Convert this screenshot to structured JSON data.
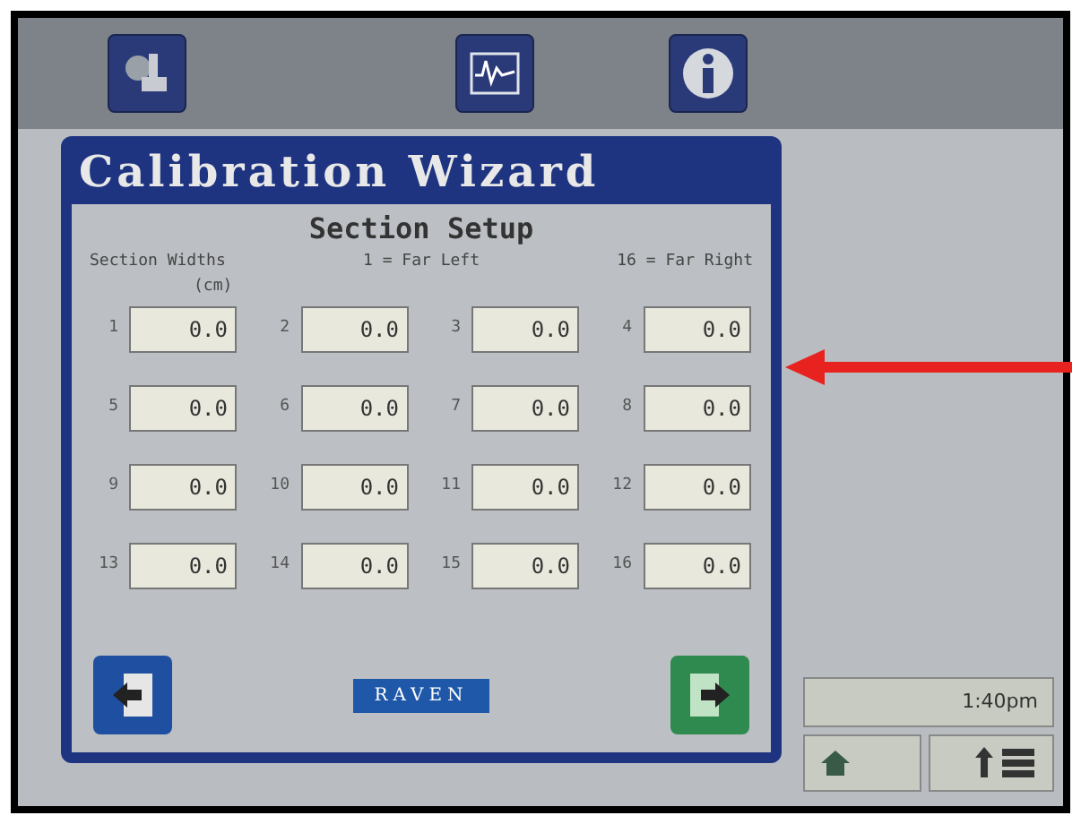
{
  "dialog": {
    "title": "Calibration Wizard",
    "subtitle": "Section Setup",
    "headers": [
      "Section Widths",
      "1 = Far Left",
      "16 = Far Right"
    ],
    "unit": "(cm)",
    "sections": [
      {
        "label": "1",
        "value": "0.0"
      },
      {
        "label": "2",
        "value": "0.0"
      },
      {
        "label": "3",
        "value": "0.0"
      },
      {
        "label": "4",
        "value": "0.0"
      },
      {
        "label": "5",
        "value": "0.0"
      },
      {
        "label": "6",
        "value": "0.0"
      },
      {
        "label": "7",
        "value": "0.0"
      },
      {
        "label": "8",
        "value": "0.0"
      },
      {
        "label": "9",
        "value": "0.0"
      },
      {
        "label": "10",
        "value": "0.0"
      },
      {
        "label": "11",
        "value": "0.0"
      },
      {
        "label": "12",
        "value": "0.0"
      },
      {
        "label": "13",
        "value": "0.0"
      },
      {
        "label": "14",
        "value": "0.0"
      },
      {
        "label": "15",
        "value": "0.0"
      },
      {
        "label": "16",
        "value": "0.0"
      }
    ],
    "logo": "RAVEN"
  },
  "status": {
    "time": "1:40pm"
  }
}
